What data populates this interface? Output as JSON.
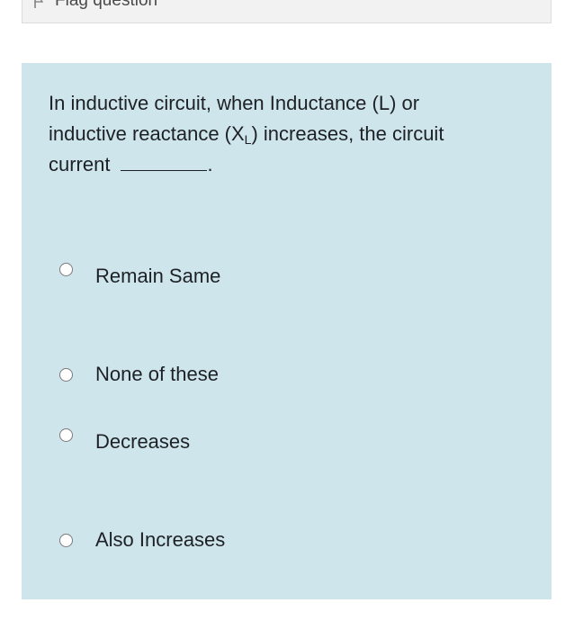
{
  "flag": {
    "label": "Flag question",
    "icon": "flag-icon"
  },
  "question": {
    "line1": "In inductive circuit, when Inductance (L) or",
    "line2_pre": "inductive reactance (X",
    "line2_sub": "L",
    "line2_post": ") increases, the circuit",
    "line3": "current",
    "line3_end": "."
  },
  "options": [
    {
      "label": "Remain Same"
    },
    {
      "label": "None of these"
    },
    {
      "label": "Decreases"
    },
    {
      "label": "Also Increases"
    }
  ],
  "colors": {
    "panel_background": "#cfe5ec",
    "text": "#1d2125"
  }
}
